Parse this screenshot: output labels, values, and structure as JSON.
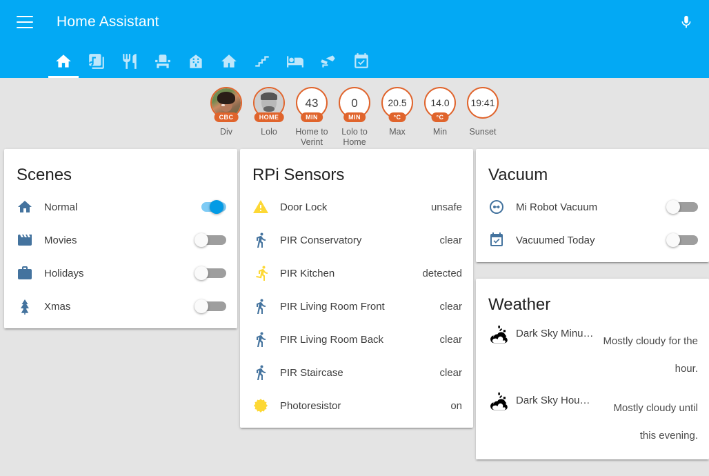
{
  "app": {
    "title": "Home Assistant",
    "menu_icon": "hamburger-menu-icon",
    "mic_icon": "microphone-icon",
    "accent_color": "#03a9f4",
    "background_color": "#e4e4e4"
  },
  "tabs": [
    {
      "icon": "home-icon",
      "name": "tab-home",
      "active": true
    },
    {
      "icon": "album-music-icon",
      "name": "tab-media",
      "active": false
    },
    {
      "icon": "silverware-fork-knife-icon",
      "name": "tab-kitchen",
      "active": false
    },
    {
      "icon": "sofa-icon",
      "name": "tab-living-room",
      "active": false
    },
    {
      "icon": "home-variant-icon",
      "name": "tab-house",
      "active": false
    },
    {
      "icon": "home-outline-icon",
      "name": "tab-outside",
      "active": false
    },
    {
      "icon": "stairs-icon",
      "name": "tab-stairs",
      "active": false
    },
    {
      "icon": "bed-icon",
      "name": "tab-bedroom",
      "active": false
    },
    {
      "icon": "cctv-icon",
      "name": "tab-cameras",
      "active": false
    },
    {
      "icon": "calendar-check-icon",
      "name": "tab-calendar",
      "active": false
    }
  ],
  "badges": {
    "border_color": "#e0642c",
    "pill_color": "#e0642c",
    "items": [
      {
        "type": "photo",
        "photo": "woman-portrait",
        "pill": "CBC",
        "label": "Div"
      },
      {
        "type": "photo",
        "photo": "man-sketch",
        "pill": "HOME",
        "label": "Lolo"
      },
      {
        "type": "value",
        "value": "43",
        "pill": "MIN",
        "label": "Home to Verint"
      },
      {
        "type": "value",
        "value": "0",
        "pill": "MIN",
        "label": "Lolo to Home"
      },
      {
        "type": "value",
        "value": "20.5",
        "pill": "°C",
        "label": "Max"
      },
      {
        "type": "value",
        "value": "14.0",
        "pill": "°C",
        "label": "Min"
      },
      {
        "type": "value",
        "value": "19:41",
        "pill": "",
        "label": "Sunset"
      }
    ]
  },
  "cards": {
    "scenes": {
      "title": "Scenes",
      "icon_color": "#44739e",
      "rows": [
        {
          "icon": "home-icon",
          "name": "Normal",
          "toggle": "on"
        },
        {
          "icon": "movie-icon",
          "name": "Movies",
          "toggle": "off"
        },
        {
          "icon": "briefcase-icon",
          "name": "Holidays",
          "toggle": "off"
        },
        {
          "icon": "pine-tree-icon",
          "name": "Xmas",
          "toggle": "off"
        }
      ]
    },
    "rpi_sensors": {
      "title": "RPi Sensors",
      "rows": [
        {
          "icon": "alert-triangle-icon",
          "color": "#fdd835",
          "name": "Door Lock",
          "state": "unsafe"
        },
        {
          "icon": "walk-icon",
          "color": "#44739e",
          "name": "PIR Conservatory",
          "state": "clear"
        },
        {
          "icon": "run-icon",
          "color": "#fdd835",
          "name": "PIR Kitchen",
          "state": "detected"
        },
        {
          "icon": "walk-icon",
          "color": "#44739e",
          "name": "PIR Living Room Front",
          "state": "clear"
        },
        {
          "icon": "walk-icon",
          "color": "#44739e",
          "name": "PIR Living Room Back",
          "state": "clear"
        },
        {
          "icon": "walk-icon",
          "color": "#44739e",
          "name": "PIR Staircase",
          "state": "clear"
        },
        {
          "icon": "brightness-sun-icon",
          "color": "#fdd835",
          "name": "Photoresistor",
          "state": "on"
        }
      ]
    },
    "vacuum": {
      "title": "Vacuum",
      "icon_color": "#44739e",
      "rows": [
        {
          "icon": "robot-vacuum-icon",
          "name": "Mi Robot Vacuum",
          "toggle": "off"
        },
        {
          "icon": "calendar-check-icon",
          "name": "Vacuumed Today",
          "toggle": "off"
        }
      ]
    },
    "weather": {
      "title": "Weather",
      "icon_color": "#000000",
      "rows": [
        {
          "icon": "weather-partly-cloudy-icon",
          "name": "Dark Sky Minute…",
          "state": "Mostly cloudy for the hour."
        },
        {
          "icon": "weather-partly-cloudy-icon",
          "name": "Dark Sky Hou…",
          "state": "Mostly cloudy until this evening."
        }
      ]
    }
  }
}
